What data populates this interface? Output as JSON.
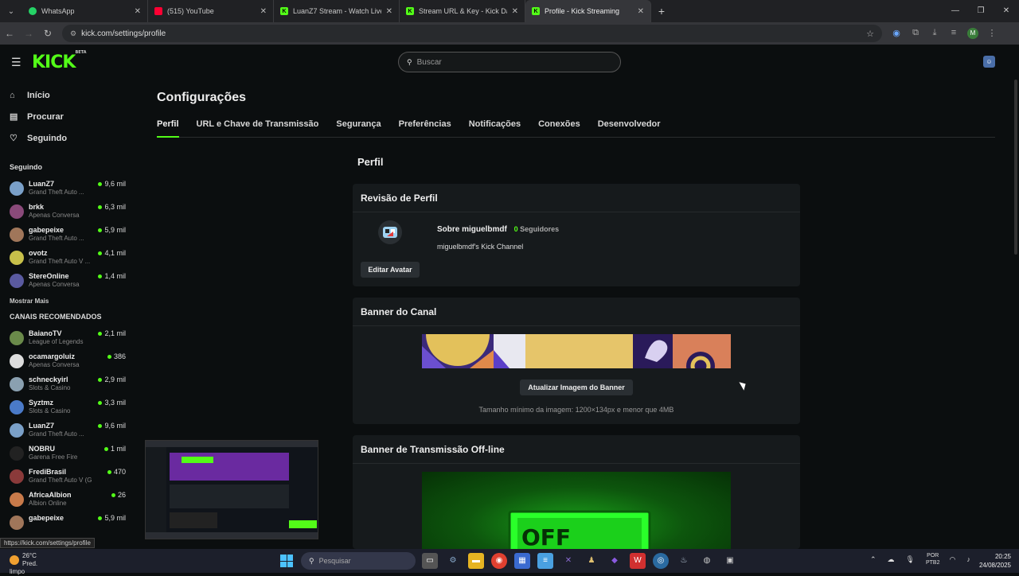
{
  "browser": {
    "tabs": [
      {
        "title": "WhatsApp",
        "color": "#25d366"
      },
      {
        "title": "(515) YouTube",
        "color": "#ff0033"
      },
      {
        "title": "LuanZ7 Stream - Watch Live on",
        "color": "#53fc18"
      },
      {
        "title": "Stream URL & Key - Kick Dashb",
        "color": "#53fc18"
      },
      {
        "title": "Profile - Kick Streaming",
        "color": "#53fc18"
      }
    ],
    "url": "kick.com/settings/profile",
    "status_url": "https://kick.com/settings/profile"
  },
  "header": {
    "logo": "KICK",
    "logo_badge": "BETA",
    "search_placeholder": "Buscar"
  },
  "sidebar": {
    "nav": [
      {
        "label": "Início",
        "icon": "home-icon"
      },
      {
        "label": "Procurar",
        "icon": "browse-icon"
      },
      {
        "label": "Seguindo",
        "icon": "heart-icon"
      }
    ],
    "following_title": "Seguindo",
    "following": [
      {
        "name": "LuanZ7",
        "category": "Grand Theft Auto ...",
        "viewers": "9,6 mil",
        "color": "#7aa0c8"
      },
      {
        "name": "brkk",
        "category": "Apenas Conversa",
        "viewers": "6,3 mil",
        "color": "#8a4a7a"
      },
      {
        "name": "gabepeixe",
        "category": "Grand Theft Auto ...",
        "viewers": "5,9 mil",
        "color": "#a0765a"
      },
      {
        "name": "ovotz",
        "category": "Grand Theft Auto V ...",
        "viewers": "4,1 mil",
        "color": "#c8c04a"
      },
      {
        "name": "StereOnline",
        "category": "Apenas Conversa",
        "viewers": "1,4 mil",
        "color": "#5a5aa0"
      }
    ],
    "show_more": "Mostrar Mais",
    "recommended_title": "CANAIS RECOMENDADOS",
    "recommended": [
      {
        "name": "BaianoTV",
        "category": "League of Legends",
        "viewers": "2,1 mil",
        "color": "#6a8a4a"
      },
      {
        "name": "ocamargoluiz",
        "category": "Apenas Conversa",
        "viewers": "386",
        "color": "#ddd"
      },
      {
        "name": "schneckyirl",
        "category": "Slots & Casino",
        "viewers": "2,9 mil",
        "color": "#8aa0b0"
      },
      {
        "name": "Syztmz",
        "category": "Slots & Casino",
        "viewers": "3,3 mil",
        "color": "#4a7ac8"
      },
      {
        "name": "LuanZ7",
        "category": "Grand Theft Auto ...",
        "viewers": "9,6 mil",
        "color": "#7aa0c8"
      },
      {
        "name": "NOBRU",
        "category": "Garena Free Fire",
        "viewers": "1 mil",
        "color": "#222"
      },
      {
        "name": "FrediBrasil",
        "category": "Grand Theft Auto V (G...",
        "viewers": "470",
        "color": "#8a3a3a"
      },
      {
        "name": "AfricaAlbion",
        "category": "Albion Online",
        "viewers": "26",
        "color": "#c87a4a"
      },
      {
        "name": "gabepeixe",
        "category": "",
        "viewers": "5,9 mil",
        "color": "#a0765a"
      }
    ]
  },
  "main": {
    "title": "Configurações",
    "tabs": [
      "Perfil",
      "URL e Chave de Transmissão",
      "Segurança",
      "Preferências",
      "Notificações",
      "Conexões",
      "Desenvolvedor"
    ],
    "section_title": "Perfil",
    "review": {
      "title": "Revisão de Perfil",
      "about": "Sobre miguelbmdf",
      "followers_count": "0",
      "followers_label": "Seguidores",
      "description": "miguelbmdf's Kick Channel",
      "edit_avatar": "Editar Avatar"
    },
    "banner": {
      "title": "Banner do Canal",
      "button": "Atualizar Imagem do Banner",
      "hint": "Tamanho mínimo da imagem: 1200×134px e menor que 4MB"
    },
    "offline": {
      "title": "Banner de Transmissão Off-line",
      "image_text": "OFF"
    }
  },
  "taskbar": {
    "temperature": "26°C",
    "weather": "Pred. limpo",
    "search_placeholder": "Pesquisar",
    "language": "POR",
    "layout": "PTB2",
    "time": "20:25",
    "date": "24/08/2025"
  },
  "colors": {
    "accent": "#53fc18",
    "background": "#0b0e0f",
    "card": "#161a1c"
  }
}
